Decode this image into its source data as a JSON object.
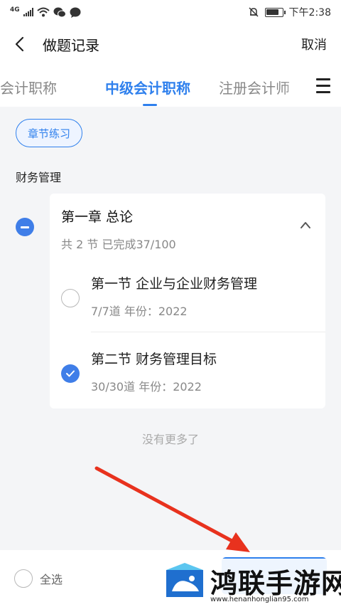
{
  "status_bar": {
    "network_label": "4G",
    "time": "下午2:38",
    "icons": [
      "signal-icon",
      "wifi-icon",
      "wechat-icon",
      "chat-icon",
      "mute-icon",
      "battery-icon"
    ]
  },
  "nav": {
    "title": "做题记录",
    "cancel_label": "取消",
    "back_icon": "chevron-left-icon"
  },
  "tabs": [
    {
      "label": "级会计职称",
      "active": false
    },
    {
      "label": "中级会计职称",
      "active": true
    },
    {
      "label": "注册会计师",
      "active": false
    }
  ],
  "tab_menu_icon": "menu-icon",
  "filter_chip": {
    "label": "章节练习"
  },
  "subject": {
    "label": "财务管理"
  },
  "chapter": {
    "title": "第一章 总论",
    "subtitle": "共 2 节  已完成37/100",
    "expanded": true,
    "sections": [
      {
        "title": "第一节  企业与企业财务管理",
        "meta": "7/7道   年份：2022",
        "checked": false
      },
      {
        "title": "第二节 财务管理目标",
        "meta": "30/30道   年份：2022",
        "checked": true
      }
    ]
  },
  "list_end_text": "没有更多了",
  "bottom_bar": {
    "select_all_label": "全选",
    "select_all_checked": false
  },
  "watermark": {
    "title": "鸿联手游网",
    "url": "www.henanhonglian95.com"
  },
  "colors": {
    "accent": "#2f80ed",
    "check_fill": "#3f7ee8",
    "annotation_arrow": "#e8321e",
    "background": "#f4f5f7"
  }
}
